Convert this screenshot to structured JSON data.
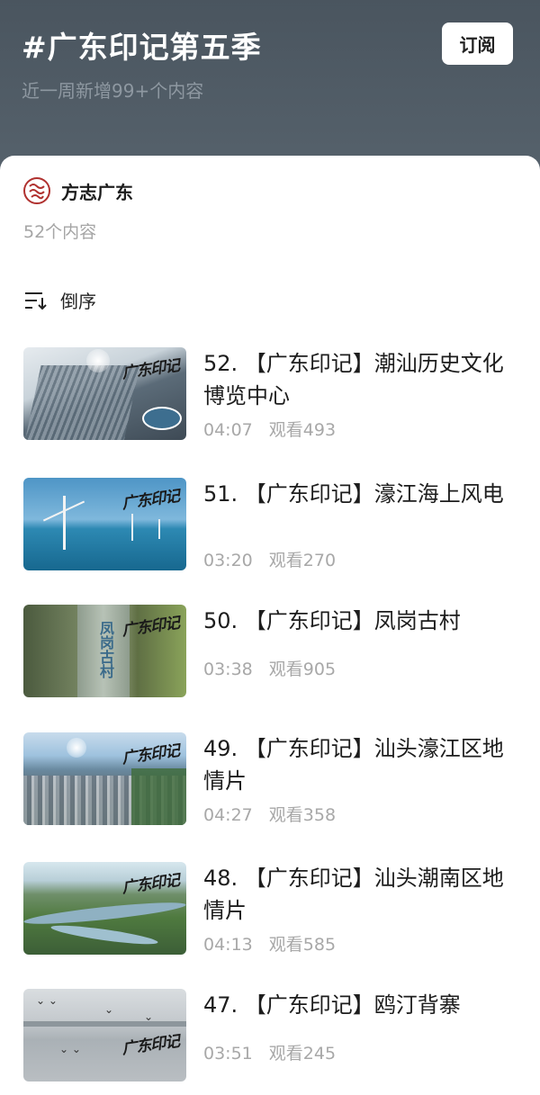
{
  "header": {
    "title": "#广东印记第五季",
    "subtitle": "近一周新增99+个内容",
    "subscribe_label": "订阅"
  },
  "author": {
    "name": "方志广东",
    "avatar_icon": "seal-logo-icon"
  },
  "content_count": "52个内容",
  "sort": {
    "icon": "sort-descending-icon",
    "label": "倒序"
  },
  "thumbnail_logo": "广东印记",
  "videos": [
    {
      "title": "52. 【广东印记】潮汕历史文化博览中心",
      "duration": "04:07",
      "views": "观看493"
    },
    {
      "title": "51. 【广东印记】濠江海上风电",
      "duration": "03:20",
      "views": "观看270"
    },
    {
      "title": "50. 【广东印记】凤岗古村",
      "duration": "03:38",
      "views": "观看905"
    },
    {
      "title": "49. 【广东印记】汕头濠江区地情片",
      "duration": "04:27",
      "views": "观看358"
    },
    {
      "title": "48. 【广东印记】汕头潮南区地情片",
      "duration": "04:13",
      "views": "观看585"
    },
    {
      "title": "47. 【广东印记】鸥汀背寨",
      "duration": "03:51",
      "views": "观看245"
    }
  ]
}
